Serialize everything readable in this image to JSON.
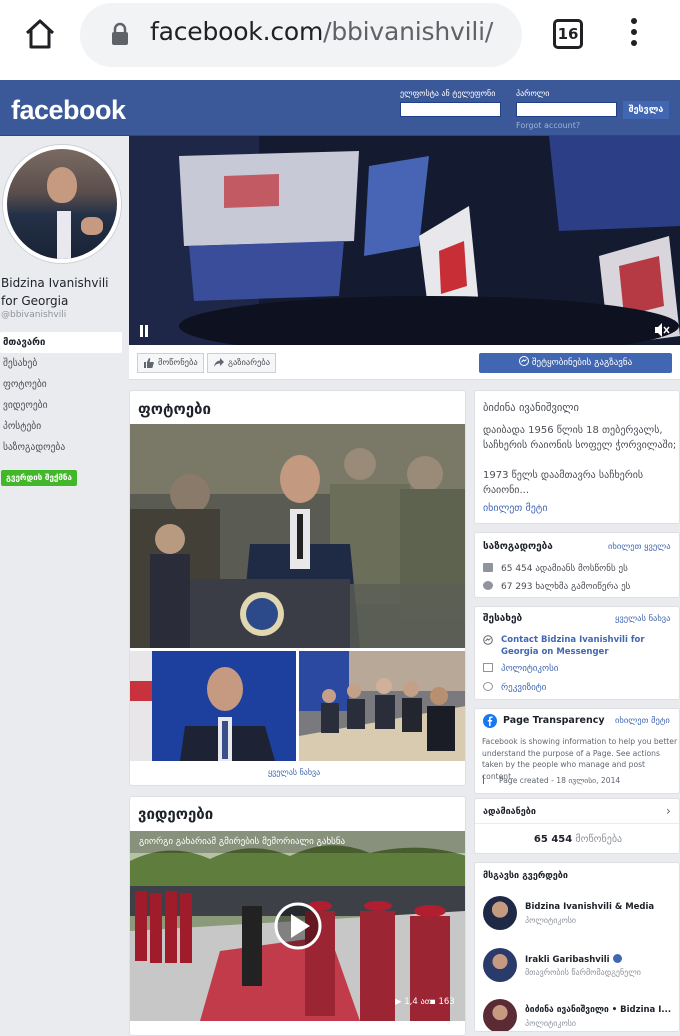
{
  "browser": {
    "url_domain": "facebook.com",
    "url_path": "/bbivanishvili/",
    "tab_count": "16"
  },
  "header": {
    "logo": "facebook",
    "email_label": "ელფოსტა ან ტელეფონი",
    "password_label": "პაროლი",
    "login_button": "შესვლა",
    "forgot": "Forgot account?"
  },
  "profile": {
    "name": "Bidzina Ivanishvili for Georgia",
    "handle": "@bbivanishvili"
  },
  "sidebar": {
    "items": [
      {
        "label": "მთავარი"
      },
      {
        "label": "შესახებ"
      },
      {
        "label": "ფოტოები"
      },
      {
        "label": "ვიდეოები"
      },
      {
        "label": "პოსტები"
      },
      {
        "label": "საზოგადოება"
      }
    ],
    "create_page": "გვერდის შექმნა"
  },
  "actions": {
    "like": "მოწონება",
    "share": "გაზიარება",
    "send_message": "შეტყობინების გაგზავნა"
  },
  "photos": {
    "title": "ფოტოები",
    "see_all": "ყველას ნახვა"
  },
  "videos": {
    "title": "ვიდეოები",
    "video_caption": "გიორგი გახარიამ გმირების მემორიალი გახსნა",
    "views": "1,4 ათ.",
    "comments": "163"
  },
  "bio": {
    "name": "ბიძინა ივანიშვილი",
    "line1": "დაიბადა 1956 წლის 18 თებერვალს, საჩხერის რაიონის სოფელ ჭორვილაში;",
    "line2": "1973 წელს დაამთავრა საჩხერის რაიონი...",
    "see_more": "იხილეთ მეტი"
  },
  "community": {
    "title": "საზოგადოება",
    "see_all": "იხილეთ ყველა",
    "likes": "65 454 ადამიანს მოსწონს ეს",
    "follows": "67 293 ხალხმა გამოიწერა ეს"
  },
  "about": {
    "title": "შესახებ",
    "see_all": "ყველას ნახვა",
    "messenger": "Contact Bidzina Ivanishvili for Georgia on Messenger",
    "category1": "პოლიტიკოსი",
    "category2": "რეკვიზიტი"
  },
  "transparency": {
    "title": "Page Transparency",
    "see_more": "იხილეთ მეტი",
    "description": "Facebook is showing information to help you better understand the purpose of a Page. See actions taken by the people who manage and post content.",
    "created": "Page created - 18 ივლისი, 2014"
  },
  "people": {
    "title": "ადამიანები",
    "count": "65 454",
    "count_label": "მოწონება"
  },
  "similar": {
    "title": "მსგავსი გვერდები",
    "items": [
      {
        "name": "Bidzina Ivanishvili & Media",
        "sub": "პოლიტიკოსი"
      },
      {
        "name": "Irakli Garibashvili",
        "sub": "მთავრობის წარმომადგენელი"
      },
      {
        "name": "ბიძინა ივანიშვილი • Bidzina I...",
        "sub": "პოლიტიკოსი"
      }
    ]
  },
  "colors": {
    "fb_blue": "#3b5998",
    "button_blue": "#4267b2",
    "green": "#42b72a"
  }
}
